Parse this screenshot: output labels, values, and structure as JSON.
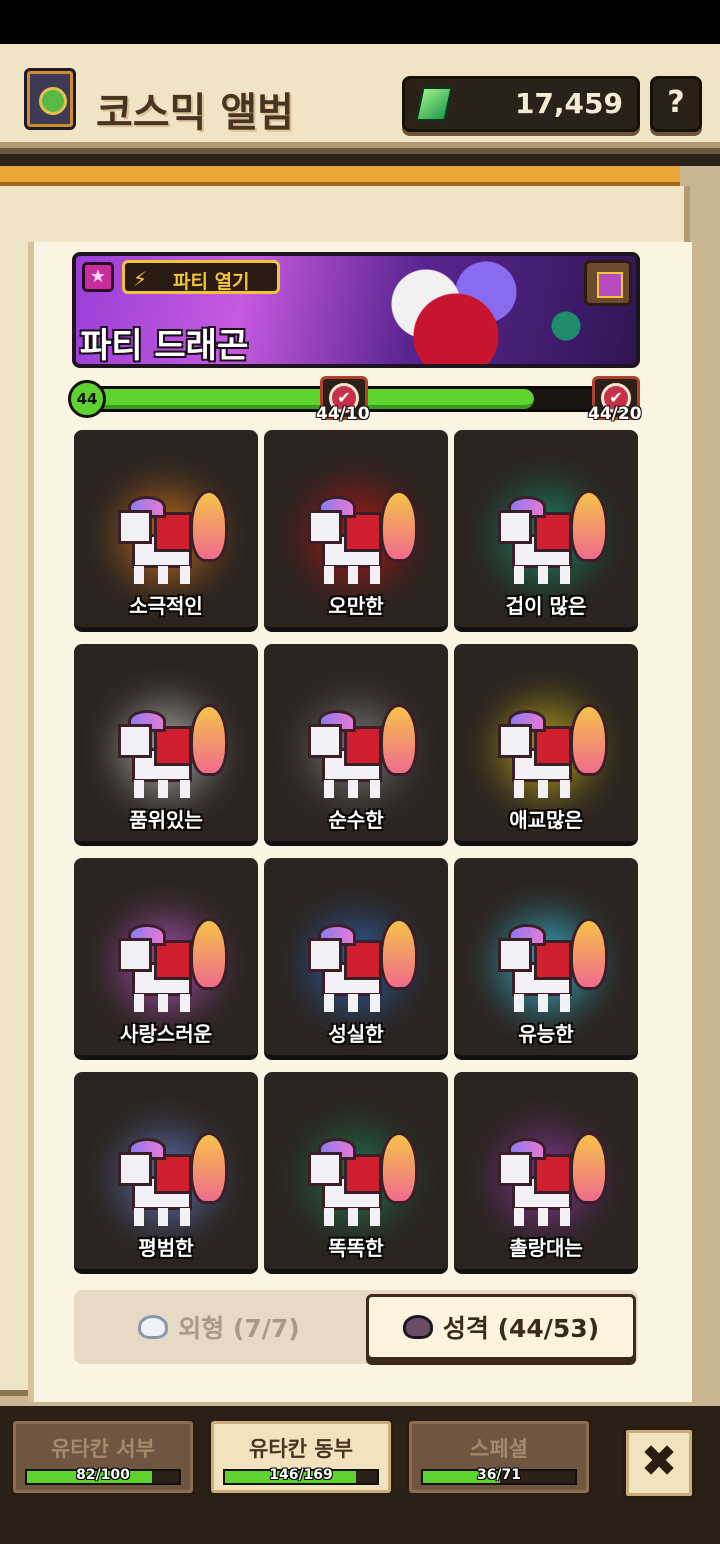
{
  "header": {
    "title": "코스믹 앨범",
    "currency_value": "17,459",
    "help_label": "?"
  },
  "banner": {
    "badge_label": "파티 열기",
    "title": "파티 드래곤"
  },
  "progress": {
    "level": "44",
    "current": 44,
    "max": 53,
    "milestones": [
      {
        "label": "44/10"
      },
      {
        "label": "44/20"
      }
    ]
  },
  "cards": [
    {
      "name": "소극적인",
      "glow": "#e7801c"
    },
    {
      "name": "오만한",
      "glow": "#d61616"
    },
    {
      "name": "겁이 많은",
      "glow": "#12a07a"
    },
    {
      "name": "품위있는",
      "glow": "#c9c9c9"
    },
    {
      "name": "순수한",
      "glow": "#8a8a8a"
    },
    {
      "name": "애교많은",
      "glow": "#d8c11a"
    },
    {
      "name": "사랑스러운",
      "glow": "#c75ad6"
    },
    {
      "name": "성실한",
      "glow": "#2a70c8"
    },
    {
      "name": "유능한",
      "glow": "#36d6f6"
    },
    {
      "name": "평범한",
      "glow": "#6a86d8"
    },
    {
      "name": "똑똑한",
      "glow": "#1f8a5c"
    },
    {
      "name": "촐랑대는",
      "glow": "#9a3ab4"
    }
  ],
  "tabs": {
    "appearance_label": "외형 (7/7)",
    "personality_label": "성격 (44/53)"
  },
  "regions": [
    {
      "name": "유타칸 서부",
      "count": "82/100",
      "progress": 0.82
    },
    {
      "name": "유타칸 동부",
      "count": "146/169",
      "progress": 0.864
    },
    {
      "name": "스페셜",
      "count": "36/71",
      "progress": 0.507
    }
  ],
  "close_label": "✖"
}
